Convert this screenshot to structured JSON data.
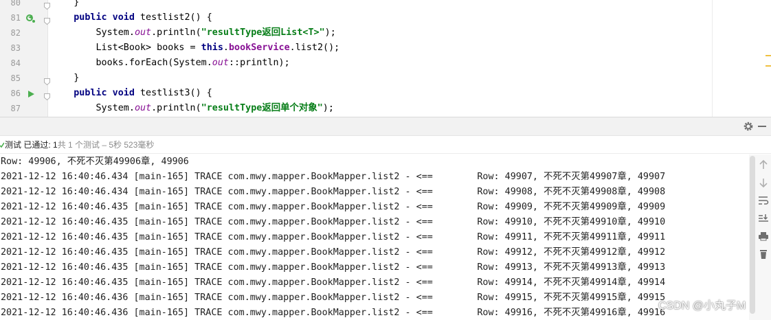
{
  "editor": {
    "lines": [
      {
        "num": "80",
        "segments": [
          {
            "t": "    }",
            "c": ""
          }
        ]
      },
      {
        "num": "81",
        "segments": [
          {
            "t": "    ",
            "c": ""
          },
          {
            "t": "public void ",
            "c": "kw"
          },
          {
            "t": "testlist2() {",
            "c": ""
          }
        ]
      },
      {
        "num": "82",
        "segments": [
          {
            "t": "        System.",
            "c": ""
          },
          {
            "t": "out",
            "c": "fld"
          },
          {
            "t": ".println(",
            "c": ""
          },
          {
            "t": "\"resultType返回List<T>\"",
            "c": "str"
          },
          {
            "t": ");",
            "c": ""
          }
        ]
      },
      {
        "num": "83",
        "segments": [
          {
            "t": "        List<Book> books = ",
            "c": ""
          },
          {
            "t": "this",
            "c": "kw"
          },
          {
            "t": ".",
            "c": ""
          },
          {
            "t": "bookService",
            "c": "fldb"
          },
          {
            "t": ".list2();",
            "c": ""
          }
        ]
      },
      {
        "num": "84",
        "segments": [
          {
            "t": "        books.forEach(System.",
            "c": ""
          },
          {
            "t": "out",
            "c": "fld"
          },
          {
            "t": "::println);",
            "c": ""
          }
        ]
      },
      {
        "num": "85",
        "segments": [
          {
            "t": "    }",
            "c": ""
          }
        ]
      },
      {
        "num": "86",
        "segments": [
          {
            "t": "    ",
            "c": ""
          },
          {
            "t": "public void ",
            "c": "kw"
          },
          {
            "t": "testlist3() {",
            "c": ""
          }
        ]
      },
      {
        "num": "87",
        "segments": [
          {
            "t": "        System.",
            "c": ""
          },
          {
            "t": "out",
            "c": "fld"
          },
          {
            "t": ".println(",
            "c": ""
          },
          {
            "t": "\"resultType返回单个对象\"",
            "c": "str"
          },
          {
            "t": ");",
            "c": ""
          }
        ]
      }
    ]
  },
  "test_status": {
    "passed_label": "测试 已通过: 1",
    "summary": "共 1 个测试 – 5秒 523毫秒"
  },
  "console": {
    "lines": [
      "Row: 49906, 不死不灭第49906章, 49906",
      "2021-12-12 16:40:46.434 [main-165] TRACE com.mwy.mapper.BookMapper.list2 - <==        Row: 49907, 不死不灭第49907章, 49907",
      "2021-12-12 16:40:46.434 [main-165] TRACE com.mwy.mapper.BookMapper.list2 - <==        Row: 49908, 不死不灭第49908章, 49908",
      "2021-12-12 16:40:46.435 [main-165] TRACE com.mwy.mapper.BookMapper.list2 - <==        Row: 49909, 不死不灭第49909章, 49909",
      "2021-12-12 16:40:46.435 [main-165] TRACE com.mwy.mapper.BookMapper.list2 - <==        Row: 49910, 不死不灭第49910章, 49910",
      "2021-12-12 16:40:46.435 [main-165] TRACE com.mwy.mapper.BookMapper.list2 - <==        Row: 49911, 不死不灭第49911章, 49911",
      "2021-12-12 16:40:46.435 [main-165] TRACE com.mwy.mapper.BookMapper.list2 - <==        Row: 49912, 不死不灭第49912章, 49912",
      "2021-12-12 16:40:46.435 [main-165] TRACE com.mwy.mapper.BookMapper.list2 - <==        Row: 49913, 不死不灭第49913章, 49913",
      "2021-12-12 16:40:46.435 [main-165] TRACE com.mwy.mapper.BookMapper.list2 - <==        Row: 49914, 不死不灭第49914章, 49914",
      "2021-12-12 16:40:46.436 [main-165] TRACE com.mwy.mapper.BookMapper.list2 - <==        Row: 49915, 不死不灭第49915章, 49915",
      "2021-12-12 16:40:46.436 [main-165] TRACE com.mwy.mapper.BookMapper.list2 - <==        Row: 49916, 不死不灭第49916章, 49916"
    ]
  },
  "toolbar": {
    "settings_icon": "gear-icon",
    "side_icons": [
      "arrow-up-icon",
      "arrow-down-icon",
      "soft-wrap-icon",
      "scroll-to-end-icon",
      "print-icon",
      "trash-icon"
    ]
  },
  "watermark": "CSDN @小丸子M",
  "colors": {
    "keyword": "#000080",
    "string": "#067d17",
    "field": "#871094",
    "run_icon": "#4caf50",
    "gutter_bg": "#f2f2f2"
  }
}
